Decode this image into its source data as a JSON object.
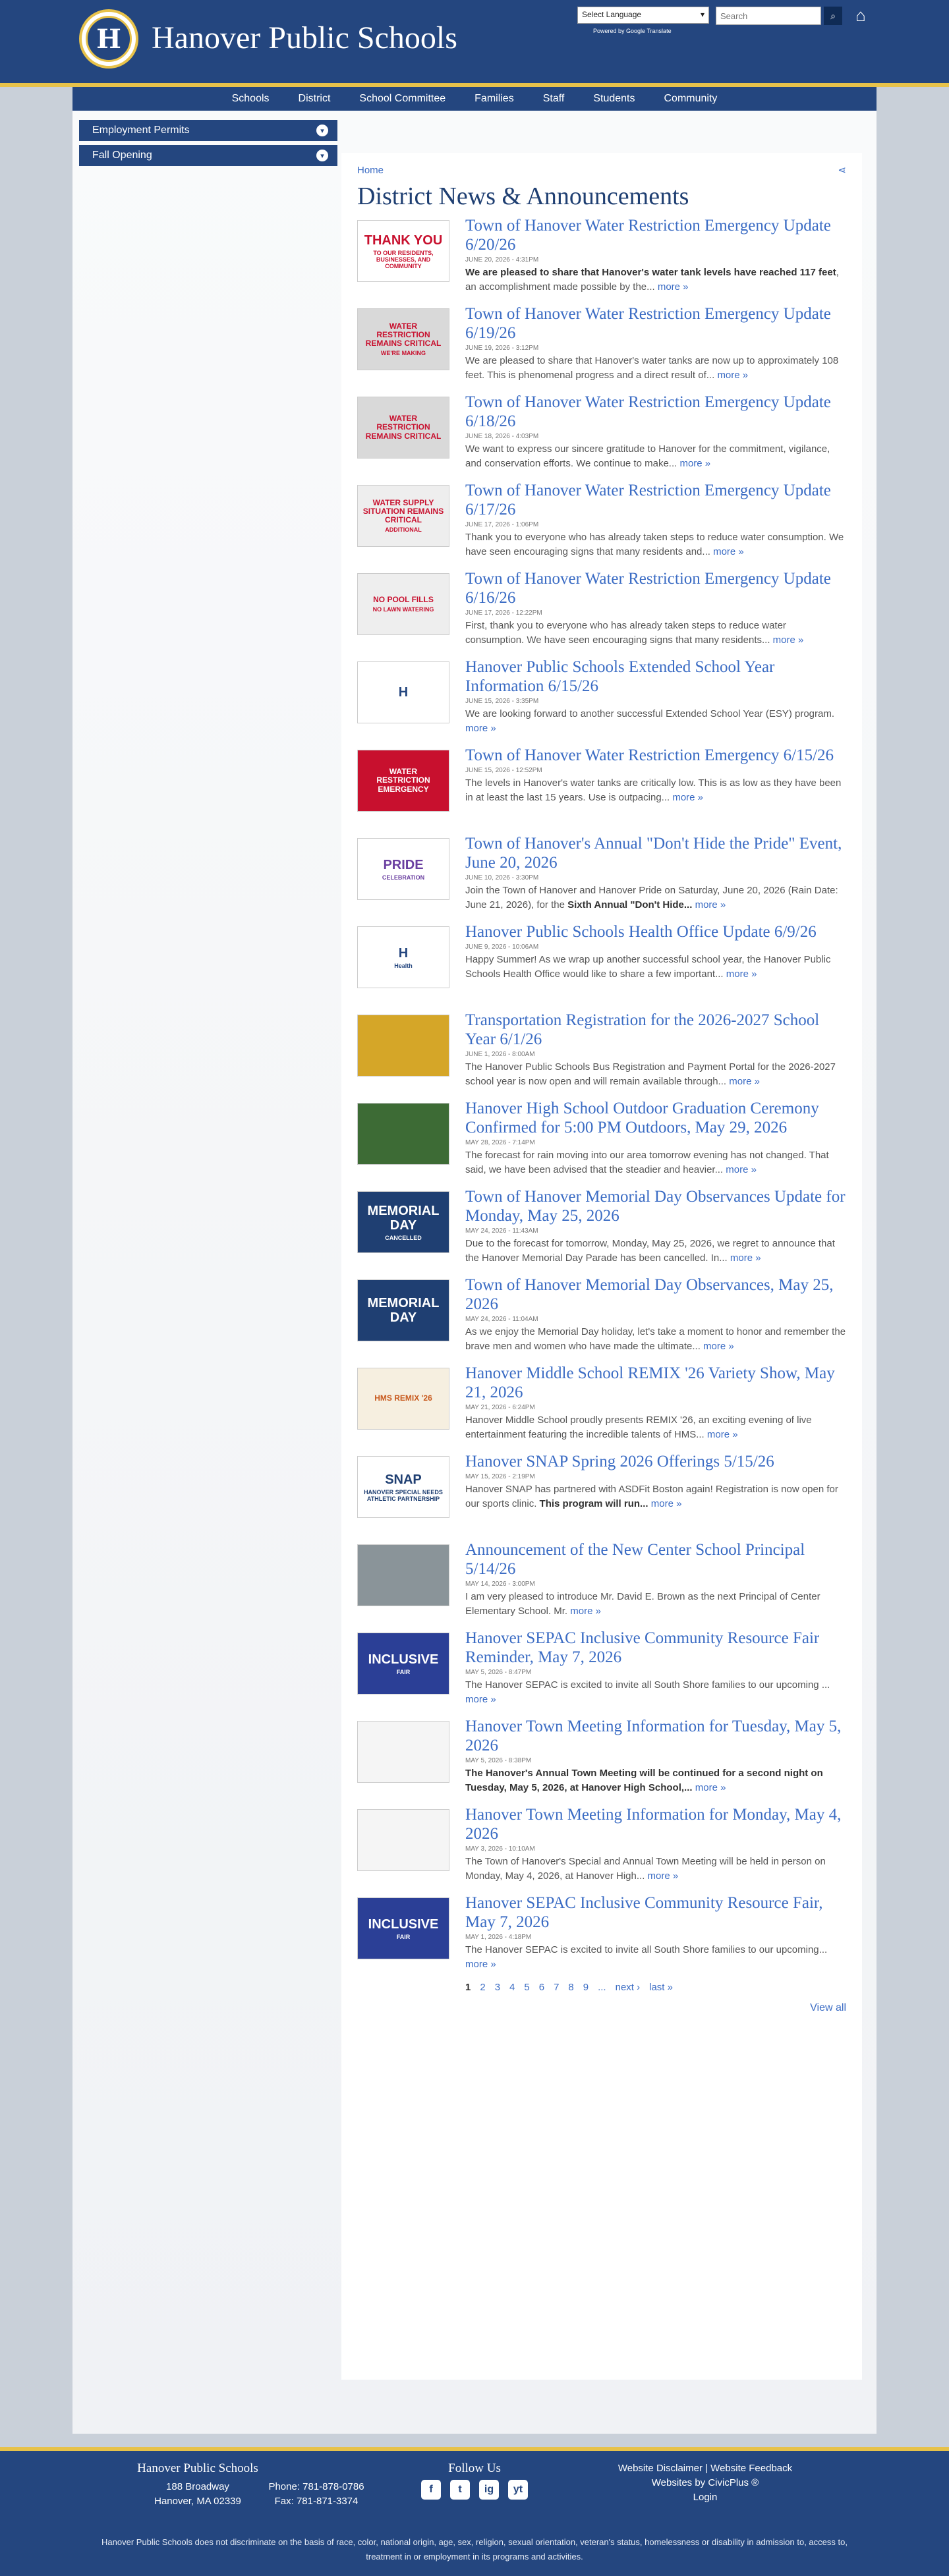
{
  "header": {
    "site_title": "Hanover Public Schools",
    "logo_letter": "H",
    "language_select": "Select Language",
    "powered_by": "Powered by Google Translate",
    "search_placeholder": "Search",
    "search_icon": "search-icon",
    "home_icon": "home-icon"
  },
  "nav": {
    "items": [
      "Schools",
      "District",
      "School Committee",
      "Families",
      "Staff",
      "Students",
      "Community"
    ]
  },
  "sidebar": {
    "items": [
      "Employment Permits",
      "Fall Opening"
    ]
  },
  "breadcrumb": "Home",
  "page_title": "District News & Announcements",
  "news": [
    {
      "title": "Town of Hanover Water Restriction Emergency Update 6/20/26",
      "date": "June 20, 2026 - 4:31PM",
      "summary_bold": "We are pleased to share that Hanover's water tank levels have reached 117 feet",
      "summary": ", an accomplishment made possible by the...",
      "thumb_text": "THANK YOU",
      "thumb_sub": "TO OUR RESIDENTS, BUSINESSES, AND COMMUNITY"
    },
    {
      "title": "Town of Hanover Water Restriction Emergency Update 6/19/26",
      "date": "June 19, 2026 - 3:12PM",
      "summary_bold": "",
      "summary": "We are pleased to share that Hanover's water tanks are now up to approximately 108 feet. This is phenomenal progress and a direct result of...",
      "thumb_text": "WATER RESTRICTION REMAINS CRITICAL",
      "thumb_sub": "WE'RE MAKING"
    },
    {
      "title": "Town of Hanover Water Restriction Emergency Update 6/18/26",
      "date": "June 18, 2026 - 4:03PM",
      "summary_bold": "",
      "summary": "We want to express our sincere gratitude to Hanover for the commitment, vigilance, and conservation efforts. We continue to make...",
      "thumb_text": "WATER RESTRICTION REMAINS CRITICAL",
      "thumb_sub": ""
    },
    {
      "title": "Town of Hanover Water Restriction Emergency Update 6/17/26",
      "date": "June 17, 2026 - 1:06PM",
      "summary_bold": "",
      "summary": "Thank you to everyone who has already taken steps to reduce water consumption. We have seen encouraging signs that many residents and...",
      "thumb_text": "WATER SUPPLY SITUATION REMAINS CRITICAL",
      "thumb_sub": "ADDITIONAL"
    },
    {
      "title": "Town of Hanover Water Restriction Emergency Update 6/16/26",
      "date": "June 17, 2026 - 12:22PM",
      "summary_bold": "",
      "summary": "First, thank you to everyone who has already taken steps to reduce water consumption. We have seen encouraging signs that many residents...",
      "thumb_text": "NO POOL FILLS",
      "thumb_sub": "NO LAWN WATERING"
    },
    {
      "title": "Hanover Public Schools Extended School Year Information 6/15/26",
      "date": "June 15, 2026 - 3:35PM",
      "summary_bold": "",
      "summary": "We are looking forward to another successful Extended School Year (ESY) program.",
      "thumb_text": "H",
      "thumb_sub": ""
    },
    {
      "title": "Town of Hanover Water Restriction Emergency 6/15/26",
      "date": "June 15, 2026 - 12:52PM",
      "summary_bold": "",
      "summary": "The levels in Hanover's water tanks are critically low. This is as low as they have been in at least the last 15 years. Use is outpacing...",
      "thumb_text": "WATER RESTRICTION EMERGENCY",
      "thumb_sub": ""
    },
    {
      "title": "Town of Hanover's Annual \"Don't Hide the Pride\" Event, June 20, 2026",
      "date": "June 10, 2026 - 3:30PM",
      "summary_bold": "Sixth Annual \"Don't Hide...",
      "summary": "Join the Town of Hanover and Hanover Pride on Saturday, June 20, 2026 (Rain Date: June 21, 2026), for the ",
      "thumb_text": "PRIDE",
      "thumb_sub": "CELEBRATION"
    },
    {
      "title": "Hanover Public Schools Health Office Update 6/9/26",
      "date": "June 9, 2026 - 10:06AM",
      "summary_bold": "",
      "summary": "Happy Summer! As we wrap up another successful school year, the Hanover Public Schools Health Office would like to share a few important...",
      "thumb_text": "H",
      "thumb_sub": "Health"
    },
    {
      "title": "Transportation Registration for the 2026-2027 School Year 6/1/26",
      "date": "June 1, 2026 - 8:00AM",
      "summary_bold": "",
      "summary": "The Hanover Public Schools Bus Registration and Payment Portal for the 2026-2027 school year is now open and will remain available through...",
      "thumb_text": "",
      "thumb_sub": ""
    },
    {
      "title": "Hanover High School Outdoor Graduation Ceremony Confirmed for 5:00 PM Outdoors, May 29, 2026",
      "date": "May 28, 2026 - 7:14PM",
      "summary_bold": "",
      "summary": "The forecast for rain moving into our area tomorrow evening has not changed. That said, we have been advised that the steadier and heavier...",
      "thumb_text": "",
      "thumb_sub": ""
    },
    {
      "title": "Town of Hanover Memorial Day Observances Update for Monday, May 25, 2026",
      "date": "May 24, 2026 - 11:43AM",
      "summary_bold": "",
      "summary": "Due to the forecast for tomorrow, Monday, May 25, 2026, we regret to announce that the Hanover Memorial Day Parade has been cancelled. In...",
      "thumb_text": "MEMORIAL DAY",
      "thumb_sub": "CANCELLED"
    },
    {
      "title": "Town of Hanover Memorial Day Observances, May 25, 2026",
      "date": "May 24, 2026 - 11:04AM",
      "summary_bold": "",
      "summary": "As we enjoy the Memorial Day holiday, let's take a moment to honor and remember the brave men and women who have made the ultimate...",
      "thumb_text": "MEMORIAL DAY",
      "thumb_sub": ""
    },
    {
      "title": "Hanover Middle School REMIX '26 Variety Show, May 21, 2026",
      "date": "May 21, 2026 - 6:24PM",
      "summary_bold": "",
      "summary": "Hanover Middle School proudly presents REMIX '26, an exciting evening of live entertainment featuring the incredible talents of HMS...",
      "thumb_text": "HMS REMIX '26",
      "thumb_sub": ""
    },
    {
      "title": "Hanover SNAP Spring 2026 Offerings 5/15/26",
      "date": "May 15, 2026 - 2:19PM",
      "summary_bold": "This program will run...",
      "summary": "Hanover SNAP has partnered with ASDFit Boston again! Registration is now open for our sports clinic. ",
      "thumb_text": "SNAP",
      "thumb_sub": "HANOVER SPECIAL NEEDS ATHLETIC PARTNERSHIP"
    },
    {
      "title": "Announcement of the New Center School Principal 5/14/26",
      "date": "May 14, 2026 - 3:00PM",
      "summary_bold": "",
      "summary": "I am very pleased to introduce Mr. David E. Brown as the next Principal of Center Elementary School. Mr.",
      "thumb_text": "",
      "thumb_sub": ""
    },
    {
      "title": "Hanover SEPAC Inclusive Community Resource Fair Reminder, May 7, 2026",
      "date": "May 5, 2026 - 8:47PM",
      "summary_bold": "",
      "summary": "The Hanover SEPAC is excited to invite all South Shore families to our upcoming ...",
      "thumb_text": "INCLUSIVE",
      "thumb_sub": "FAIR"
    },
    {
      "title": "Hanover Town Meeting Information for Tuesday, May 5, 2026",
      "date": "May 5, 2026 - 8:38PM",
      "summary_bold": "The Hanover's Annual Town Meeting will be continued for a second night on Tuesday, May 5, 2026, at Hanover High School,...",
      "summary": "",
      "thumb_text": "",
      "thumb_sub": ""
    },
    {
      "title": "Hanover Town Meeting Information for Monday, May 4, 2026",
      "date": "May 3, 2026 - 10:10AM",
      "summary_bold": "",
      "summary": "The Town of Hanover's Special and Annual Town Meeting will be held in person on Monday, May 4, 2026, at Hanover High...",
      "thumb_text": "",
      "thumb_sub": ""
    },
    {
      "title": "Hanover SEPAC Inclusive Community Resource Fair, May 7, 2026",
      "date": "May 1, 2026 - 4:18PM",
      "summary_bold": "",
      "summary": "The Hanover SEPAC is excited to invite all South Shore families to our upcoming...",
      "thumb_text": "INCLUSIVE",
      "thumb_sub": "FAIR"
    }
  ],
  "more_label": "more »",
  "pager": {
    "pages": [
      "1",
      "2",
      "3",
      "4",
      "5",
      "6",
      "7",
      "8",
      "9",
      "..."
    ],
    "next": "next ›",
    "last": "last »"
  },
  "view_all": "View all",
  "footer": {
    "school_name": "Hanover Public Schools",
    "address1": "188 Broadway",
    "address2": "Hanover, MA 02339",
    "phone": "Phone: 781-878-0786",
    "fax": "Fax: 781-871-3374",
    "follow_title": "Follow Us",
    "social": [
      "f",
      "t",
      "ig",
      "yt"
    ],
    "links": [
      "Website Disclaimer | Website Feedback",
      "Websites by CivicPlus ®",
      "Login"
    ],
    "nondiscrimination": "Hanover Public Schools does not discriminate on the basis of race, color, national origin, age, sex, religion, sexual orientation, veteran's status, homelessness or disability in admission to, access to, treatment in or employment in its programs and activities."
  },
  "colors": {
    "brand_blue": "#24467f",
    "gold": "#e7c24a",
    "link": "#3b6cc4",
    "title": "#1f3f72"
  }
}
